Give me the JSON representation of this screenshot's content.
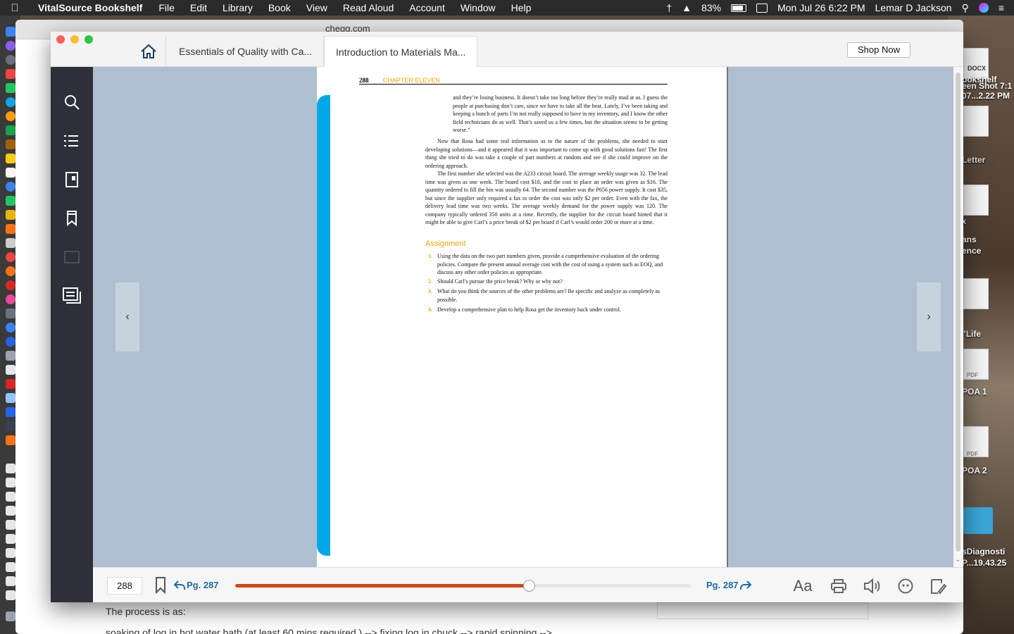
{
  "menubar": {
    "app_name": "VitalSource Bookshelf",
    "items": [
      "File",
      "Edit",
      "Library",
      "Book",
      "View",
      "Read Aloud",
      "Account",
      "Window",
      "Help"
    ],
    "battery": "83%",
    "datetime": "Mon Jul 26  6:22 PM",
    "user": "Lemar D Jackson"
  },
  "background_window": {
    "url": "chegg.com",
    "text_line1": "The process is as:",
    "text_line2": "soaking of log in hot water bath (at least 60 mins required ) --> fixing log in chuck --> rapid spinning -->"
  },
  "desktop": {
    "labels": [
      "DOCX",
      "ookshelf",
      "een Shot 7:1",
      "07...2.22 PM",
      "Letter",
      "X",
      "ans",
      "ence",
      "\"Life",
      "PDF",
      "POA 1",
      "PDF",
      "POA 2",
      "sDiagnosti",
      "P...19.43.25"
    ]
  },
  "vitalsource": {
    "tabs": [
      "Essentials of Quality with Ca...",
      "Introduction to Materials Ma..."
    ],
    "shop_now": "Shop Now",
    "page_header_num": "288",
    "page_header_chapter": "CHAPTER ELEVEN",
    "quote": "and they’re losing business. It doesn’t take too long before they’re really mad at us. I guess the people at purchasing don’t care, since we have to take all the heat. Lately, I’ve been taking and keeping a bunch of parts I’m not really supposed to have in my inventory, and I know the other field technicians do as well. That’s saved us a few times, but the situation seems to be getting worse.”",
    "para1": "Now that Rosa had some real information as to the nature of the problems, she needed to start developing solutions—and it appeared that it was important to come up with good solutions fast! The first thing she tried to do was take a couple of part numbers at random and see if she could improve on the ordering approach.",
    "para2": "The first number she selected was the A233 circuit board. The average weekly usage was 32. The lead time was given as one week. The board cost $18, and the cost to place an order was given as $16. The quantity ordered to fill the bin was usually 64. The second number was the P656 power supply. It cost $35, but since the supplier only required a fax to order the cost was only $2 per order. Even with the fax, the delivery lead time was two weeks. The average weekly demand for the power supply was 120. The company typically ordered 350 units at a time. Recently, the supplier for the circuit board hinted that it might be able to give Carl’s a price break of $2 per board if Carl’s would order 200 or more at a time.",
    "assignment_heading": "Assignment",
    "assignments": [
      {
        "num": "1.",
        "text": "Using the data on the two part numbers given, provide a comprehensive evaluation of the ordering policies. Compare the present annual average cost with the cost of using a system such as EOQ, and discuss any other order policies as appropriate."
      },
      {
        "num": "2.",
        "text": "Should Carl’s pursue the price break? Why or why not?"
      },
      {
        "num": "3.",
        "text": "What do you think the sources of the other problems are? Be specific and analyze as completely as possible."
      },
      {
        "num": "4.",
        "text": "Develop a comprehensive plan to help Rosa get the inventory back under control."
      }
    ],
    "bottom": {
      "page_value": "288",
      "back_label": "Pg. 287",
      "forward_label": "Pg. 287",
      "progress_fraction": 0.643
    },
    "prev_arrow": "‹",
    "next_arrow": "›",
    "aa_label": "Aa"
  }
}
